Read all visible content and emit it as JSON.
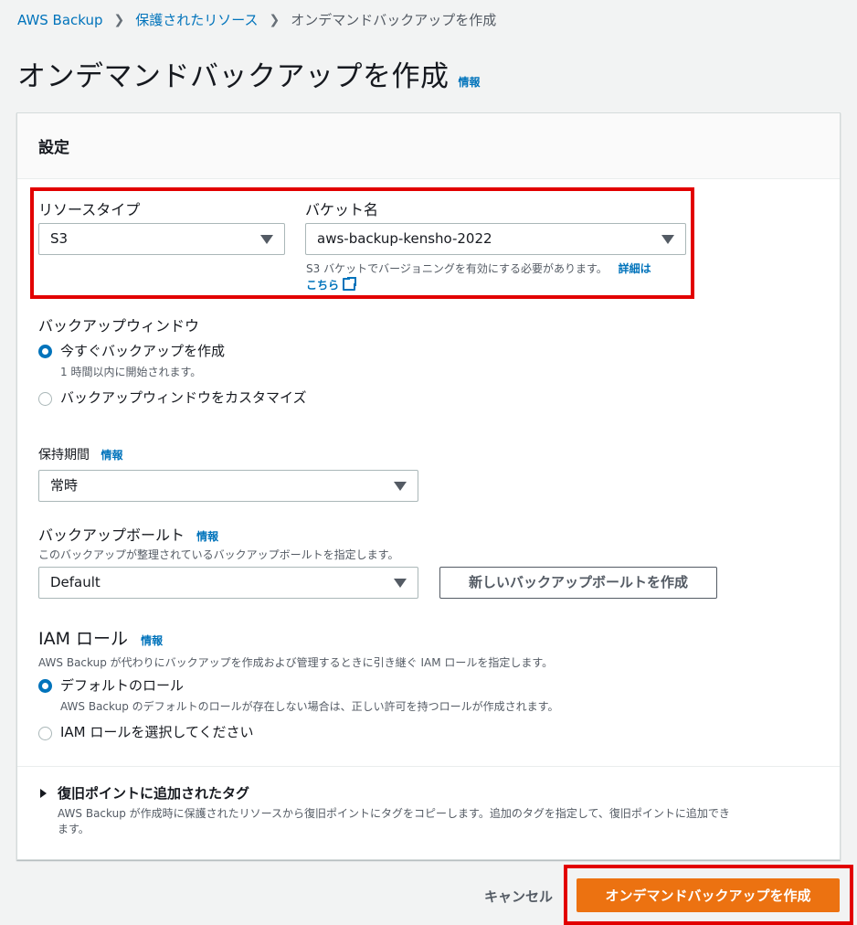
{
  "breadcrumb": {
    "items": [
      "AWS Backup",
      "保護されたリソース",
      "オンデマンドバックアップを作成"
    ],
    "separator": ">"
  },
  "header": {
    "title": "オンデマンドバックアップを作成",
    "info": "情報"
  },
  "settings": {
    "title": "設定",
    "resource_type": {
      "label": "リソースタイプ",
      "value": "S3"
    },
    "bucket_name": {
      "label": "バケット名",
      "value": "aws-backup-kensho-2022",
      "hint": "S3 バケットでバージョニングを有効にする必要があります。",
      "learn_more_line1": "詳細は",
      "learn_more_line2": "こちら"
    },
    "backup_window": {
      "label": "バックアップウィンドウ",
      "option_now": "今すぐバックアップを作成",
      "option_now_desc": "1 時間以内に開始されます。",
      "option_custom": "バックアップウィンドウをカスタマイズ"
    },
    "retention": {
      "label": "保持期間",
      "info": "情報",
      "value": "常時"
    },
    "vault": {
      "label": "バックアップボールト",
      "info": "情報",
      "desc": "このバックアップが整理されているバックアップボールトを指定します。",
      "value": "Default",
      "create_button": "新しいバックアップボールトを作成"
    },
    "iam_role": {
      "label": "IAM ロール",
      "info": "情報",
      "desc": "AWS Backup が代わりにバックアップを作成および管理するときに引き継ぐ IAM ロールを指定します。",
      "option_default": "デフォルトのロール",
      "option_default_desc": "AWS Backup のデフォルトのロールが存在しない場合は、正しい許可を持つロールが作成されます。",
      "option_choose": "IAM ロールを選択してください"
    },
    "tags": {
      "title": "復旧ポイントに追加されたタグ",
      "desc_line1": "AWS Backup が作成時に保護されたリソースから復旧ポイントにタグをコピーします。追加のタグを指定して、復旧ポイントに追加でき",
      "desc_line2": "ます。"
    }
  },
  "footer": {
    "cancel": "キャンセル",
    "submit": "オンデマンドバックアップを作成"
  },
  "colors": {
    "link": "#0073bb",
    "primary": "#ec7211",
    "highlight": "#e20000",
    "background": "#f2f3f3"
  },
  "icons": {
    "breadcrumb_separator": "chevron-right-icon",
    "dropdown": "caret-down-icon",
    "external_link": "external-link-icon",
    "expand": "caret-right-icon"
  }
}
